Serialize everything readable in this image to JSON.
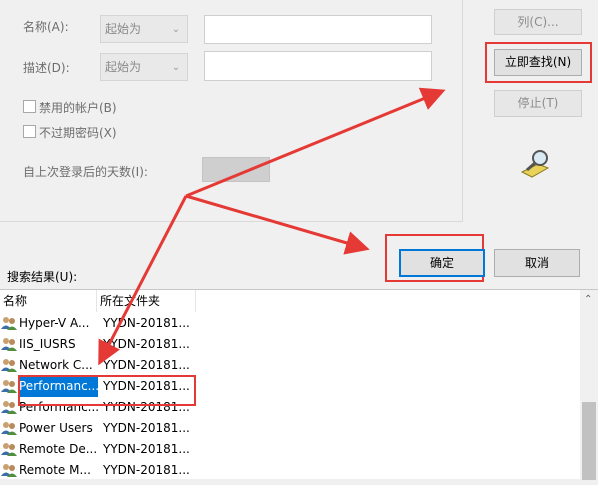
{
  "form": {
    "name_label": "名称(A):",
    "desc_label": "描述(D):",
    "name_mode": "起始为",
    "desc_mode": "起始为",
    "disabled_accounts": "禁用的帐户(B)",
    "non_expiring_password": "不过期密码(X)",
    "days_since_logon": "自上次登录后的天数(I):"
  },
  "buttons": {
    "columns": "列(C)...",
    "find_now": "立即查找(N)",
    "stop": "停止(T)",
    "ok": "确定",
    "cancel": "取消"
  },
  "results": {
    "label": "搜索结果(U):",
    "col_name": "名称",
    "col_folder": "所在文件夹",
    "rows": [
      {
        "name": "Hyper-V A...",
        "folder": "YYDN-20181..."
      },
      {
        "name": "IIS_IUSRS",
        "folder": "YYDN-20181..."
      },
      {
        "name": "Network C...",
        "folder": "YYDN-20181..."
      },
      {
        "name": "Performanc...",
        "folder": "YYDN-20181..."
      },
      {
        "name": "Performanc...",
        "folder": "YYDN-20181..."
      },
      {
        "name": "Power Users",
        "folder": "YYDN-20181..."
      },
      {
        "name": "Remote De...",
        "folder": "YYDN-20181..."
      },
      {
        "name": "Remote M...",
        "folder": "YYDN-20181..."
      }
    ],
    "selected_index": 3
  },
  "colors": {
    "selection": "#0078d7",
    "annotation": "#e53935"
  }
}
